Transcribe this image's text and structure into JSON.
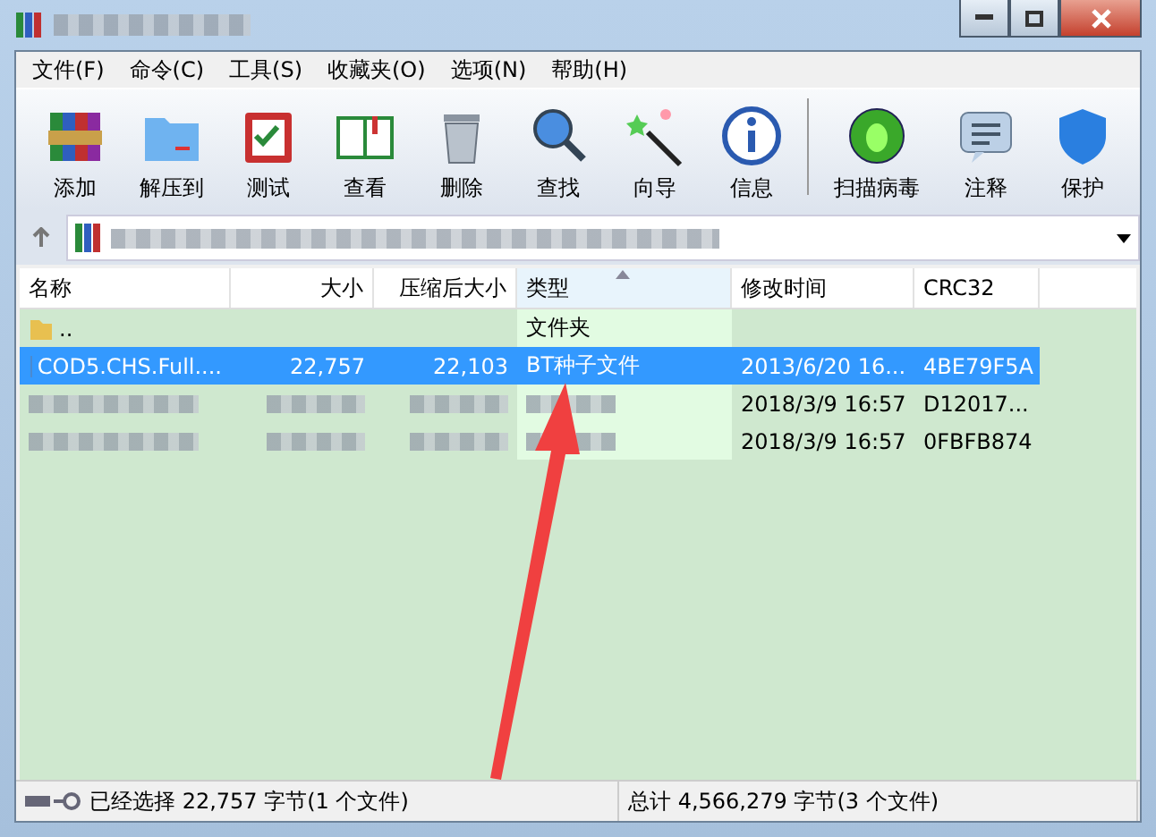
{
  "menu": [
    {
      "label": "文件(F)"
    },
    {
      "label": "命令(C)"
    },
    {
      "label": "工具(S)"
    },
    {
      "label": "收藏夹(O)"
    },
    {
      "label": "选项(N)"
    },
    {
      "label": "帮助(H)"
    }
  ],
  "toolbar": [
    {
      "label": "添加"
    },
    {
      "label": "解压到"
    },
    {
      "label": "测试"
    },
    {
      "label": "查看"
    },
    {
      "label": "删除"
    },
    {
      "label": "查找"
    },
    {
      "label": "向导"
    },
    {
      "label": "信息"
    },
    {
      "label": "扫描病毒"
    },
    {
      "label": "注释"
    },
    {
      "label": "保护"
    }
  ],
  "columns": [
    {
      "label": "名称",
      "sorted": false
    },
    {
      "label": "大小",
      "sorted": false
    },
    {
      "label": "压缩后大小",
      "sorted": false
    },
    {
      "label": "类型",
      "sorted": true
    },
    {
      "label": "修改时间",
      "sorted": false
    },
    {
      "label": "CRC32",
      "sorted": false
    }
  ],
  "rows": [
    {
      "kind": "folder",
      "name": "..",
      "size": "",
      "packed": "",
      "type": "文件夹",
      "modified": "",
      "crc": "",
      "selected": false
    },
    {
      "kind": "torrent",
      "name": "COD5.CHS.Full....",
      "size": "22,757",
      "packed": "22,103",
      "type": "BT种子文件",
      "modified": "2013/6/20 16...",
      "crc": "4BE79F5A",
      "selected": true
    },
    {
      "kind": "redacted",
      "modified": "2018/3/9 16:57",
      "crc": "D12017...",
      "selected": false
    },
    {
      "kind": "redacted",
      "modified": "2018/3/9 16:57",
      "crc": "0FBFB874",
      "selected": false
    }
  ],
  "status": {
    "left": "已经选择 22,757 字节(1 个文件)",
    "right": "总计 4,566,279 字节(3 个文件)"
  }
}
